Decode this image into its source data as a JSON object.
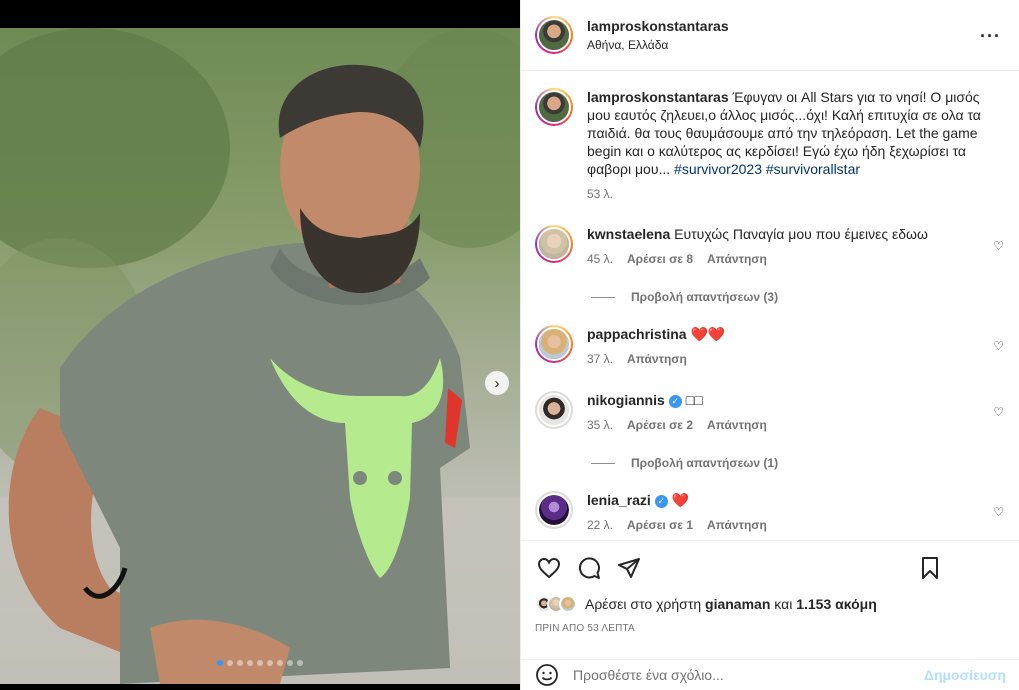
{
  "post": {
    "username": "lamproskonstantaras",
    "location": "Αθήνα, Ελλάδα",
    "more_icon": "more-horizontal-icon"
  },
  "caption": {
    "username": "lamproskonstantaras",
    "text": "Έφυγαν οι All Stars για το νησί! Ο μισός μου εαυτός ζηλευει,ο άλλος μισός...όχι! Καλή επιτυχία σε ολα τα παιδιά. θα τους θαυμάσουμε από την τηλεόραση. Let the game begin και ο καλύτερος ας κερδίσει! Εγώ έχω ήδη ξεχωρίσει τα φαβορι μου...",
    "hashtag1": "#survivor2023",
    "hashtag2": "#survivorallstar",
    "time": "53 λ."
  },
  "comments": [
    {
      "username": "kwnstaelena",
      "text": "Ευτυχώς Παναγία μου που έμεινες εδωω",
      "time": "45 λ.",
      "likes": "Αρέσει σε 8",
      "reply": "Απάντηση",
      "view_replies": "Προβολή απαντήσεων (3)"
    },
    {
      "username": "pappachristina",
      "text": "❤️❤️",
      "time": "37 λ.",
      "reply": "Απάντηση"
    },
    {
      "username": "nikogiannis",
      "text": "□□",
      "time": "35 λ.",
      "likes": "Αρέσει σε 2",
      "reply": "Απάντηση",
      "view_replies": "Προβολή απαντήσεων (1)"
    },
    {
      "username": "lenia_razi",
      "text": "❤️",
      "time": "22 λ.",
      "likes": "Αρέσει σε 1",
      "reply": "Απάντηση"
    }
  ],
  "likes_line": {
    "prefix": "Αρέσει στο χρήστη",
    "user": "gianaman",
    "and": "και",
    "count": "1.153 ακόμη"
  },
  "post_time": "ΠΡΙΝ ΑΠΟ 53 ΛΕΠΤΑ",
  "add_comment": {
    "placeholder": "Προσθέστε ένα σχόλιο...",
    "publish": "Δημοσίευση"
  },
  "carousel": {
    "slides": 9,
    "active": 1
  },
  "colors": {
    "link": "#00376b",
    "muted": "#737373",
    "heart": "#ed4956",
    "publish": "#b2dffc",
    "verified": "#3897f0"
  }
}
